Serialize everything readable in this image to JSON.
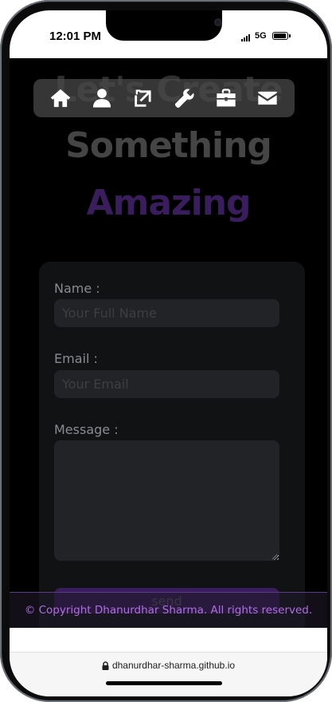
{
  "status_bar": {
    "time": "12:01 PM",
    "network": "5G"
  },
  "hero": {
    "line1": "Let's Create",
    "line2": "Something",
    "line3": "Amazing"
  },
  "nav": {
    "icons": [
      "home-icon",
      "user-icon",
      "projects-icon",
      "tools-icon",
      "briefcase-icon",
      "mail-icon"
    ]
  },
  "form": {
    "name_label": "Name :",
    "name_placeholder": "Your Full Name",
    "email_label": "Email :",
    "email_placeholder": "Your Email",
    "message_label": "Message :",
    "send_label": "send"
  },
  "footer": {
    "copyright": "© Copyright Dhanurdhar Sharma. All rights reserved."
  },
  "browser": {
    "url": "dhanurdhar-sharma.github.io"
  },
  "colors": {
    "background": "#000000",
    "accent": "#3a1d5c",
    "footer_text": "#b06de3",
    "card": "#111214",
    "input": "#222327"
  }
}
